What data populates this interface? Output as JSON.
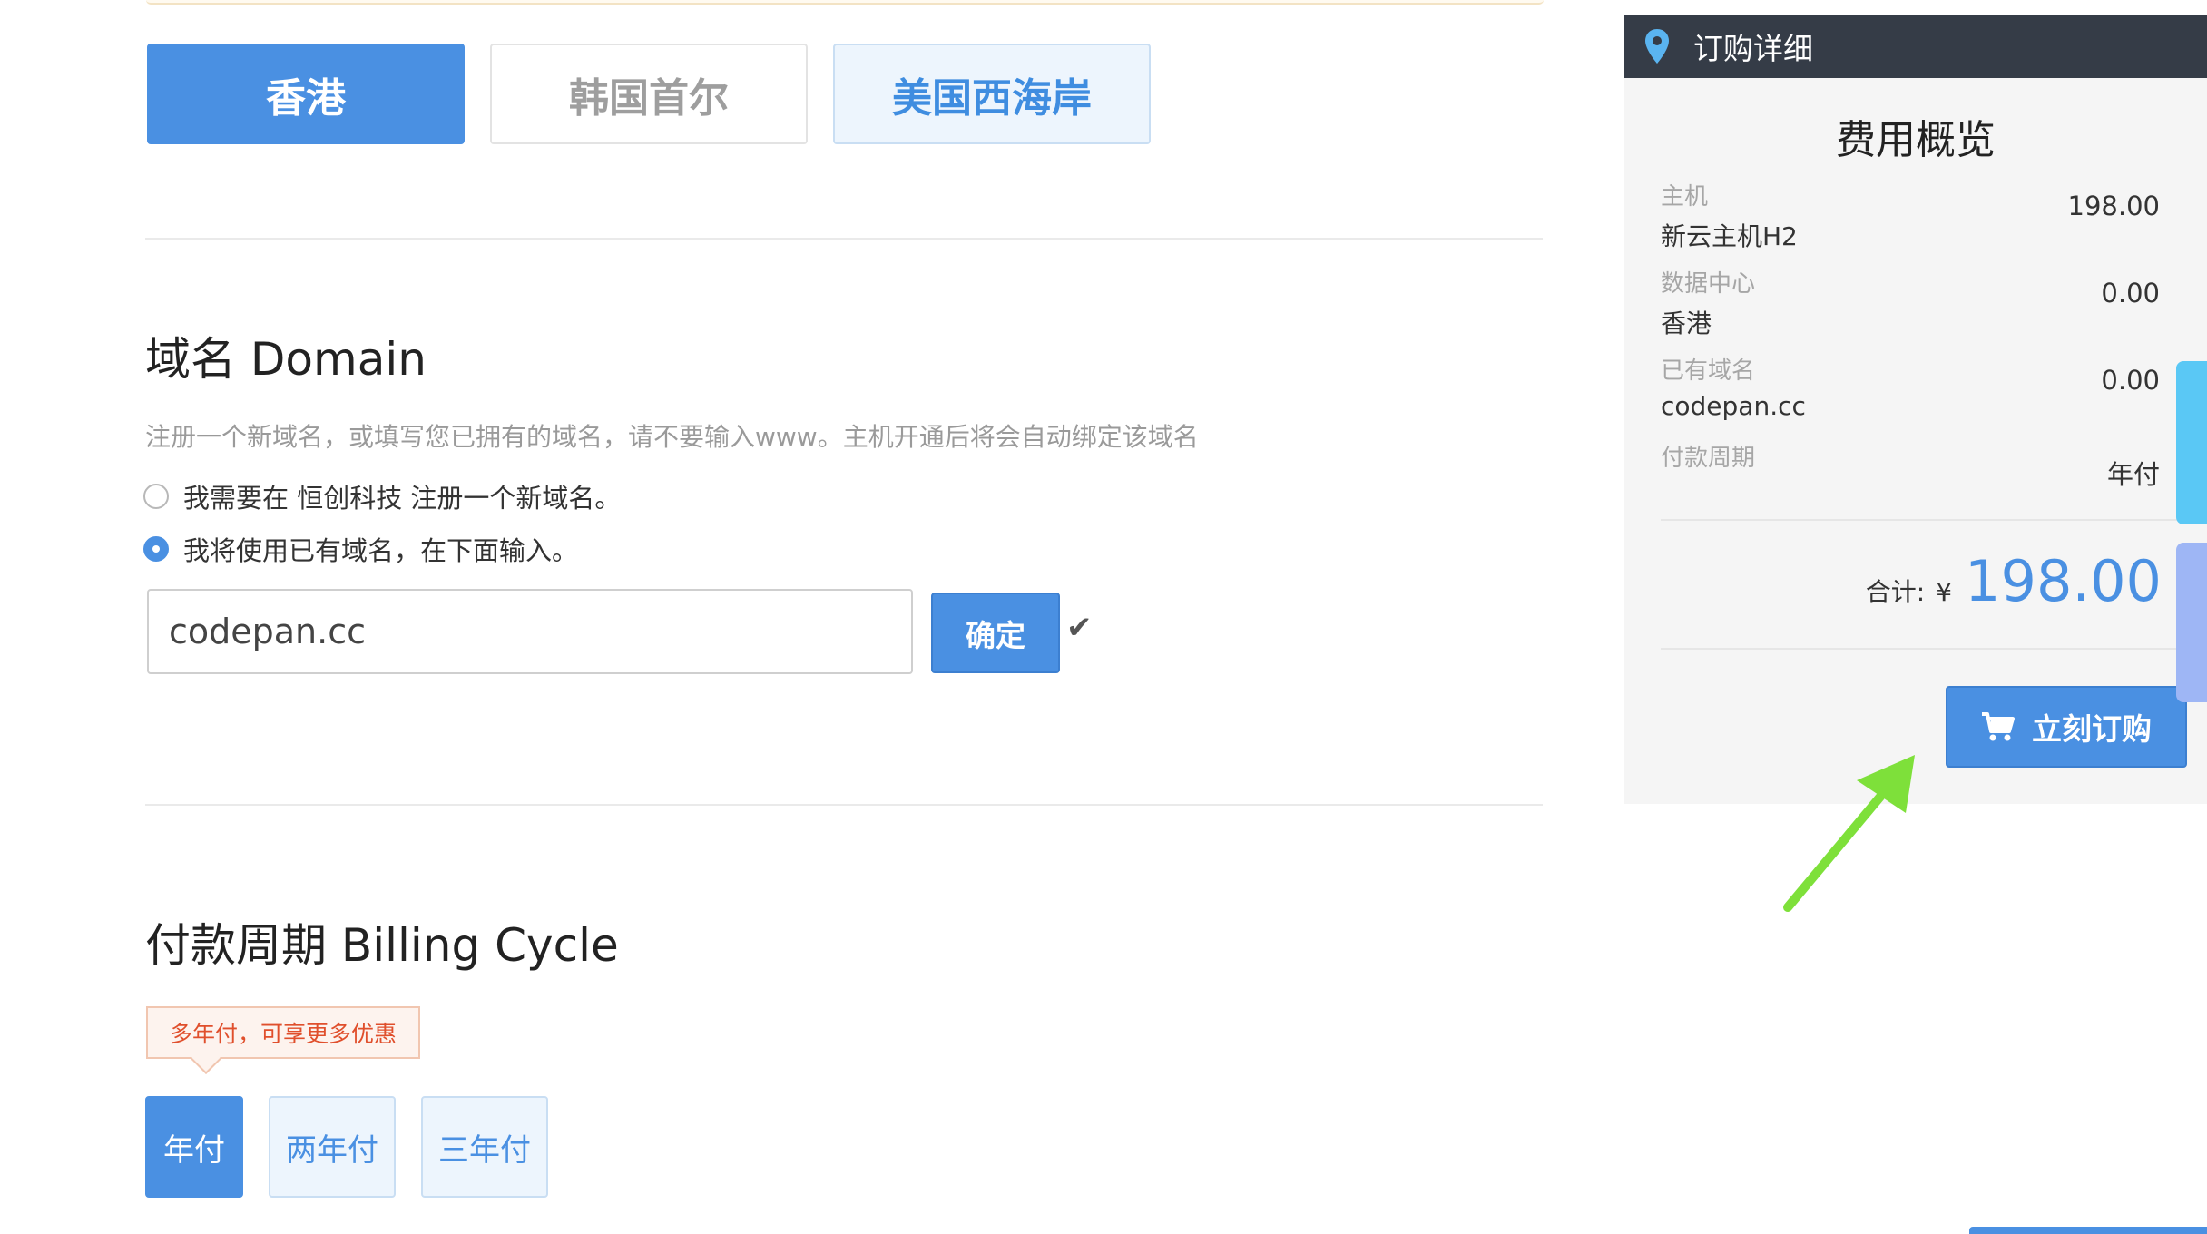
{
  "datacenters": {
    "options": [
      "香港",
      "韩国首尔",
      "美国西海岸"
    ],
    "selected": "香港"
  },
  "domain": {
    "title": "域名 Domain",
    "description": "注册一个新域名，或填写您已拥有的域名，请不要输入www。主机开通后将会自动绑定该域名",
    "option_register": "我需要在 恒创科技 注册一个新域名。",
    "option_existing": "我将使用已有域名，在下面输入。",
    "selected_option": "existing",
    "input_value": "codepan.cc",
    "confirm_label": "确定"
  },
  "billing": {
    "title": "付款周期 Billing Cycle",
    "tooltip": "多年付，可享更多优惠",
    "options": [
      "年付",
      "两年付",
      "三年付"
    ],
    "selected": "年付"
  },
  "order": {
    "header_title": "订购详细",
    "panel_title": "费用概览",
    "items": [
      {
        "label": "主机",
        "value": "新云主机H2",
        "price": "198.00"
      },
      {
        "label": "数据中心",
        "value": "香港",
        "price": "0.00"
      },
      {
        "label": "已有域名",
        "value": "codepan.cc",
        "price": "0.00"
      },
      {
        "label": "付款周期",
        "value": "",
        "price": "年付"
      }
    ],
    "total_label": "合计:",
    "currency": "¥",
    "total_amount": "198.00",
    "buy_label": "立刻订购"
  },
  "colors": {
    "accent": "#4a90e2",
    "header_bg": "#353c47",
    "annotation_arrow": "#7ee03a",
    "tooltip_text": "#e04f2c"
  }
}
